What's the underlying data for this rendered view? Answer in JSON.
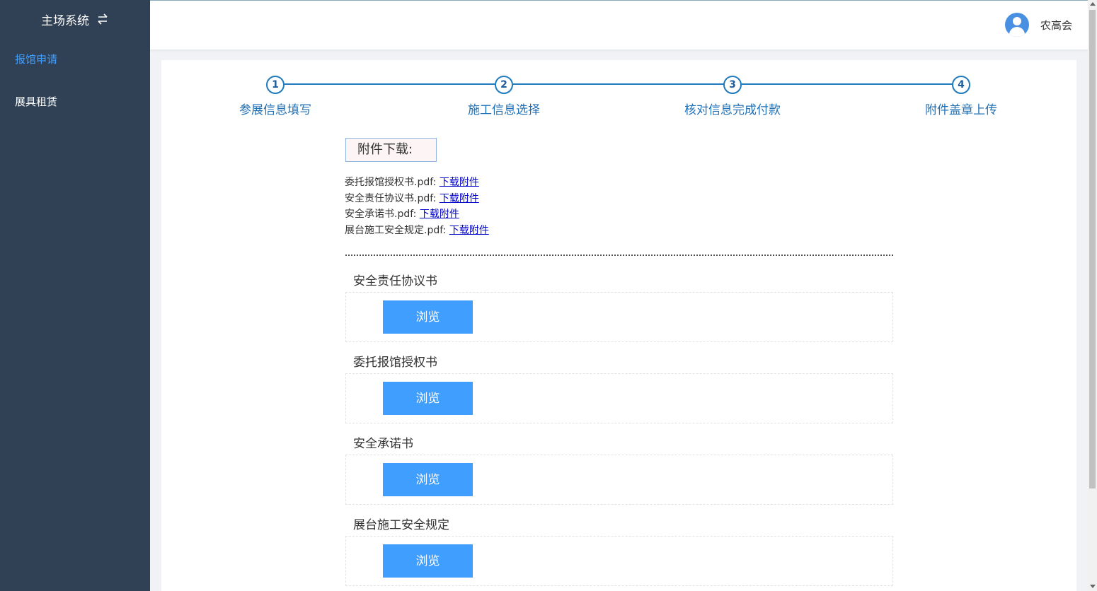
{
  "sidebar": {
    "title": "主场系统",
    "items": [
      {
        "label": "报馆申请",
        "active": true
      },
      {
        "label": "展具租赁",
        "active": false
      }
    ]
  },
  "header": {
    "user_name": "农高会"
  },
  "steps": [
    {
      "number": "1",
      "label": "参展信息填写"
    },
    {
      "number": "2",
      "label": "施工信息选择"
    },
    {
      "number": "3",
      "label": "核对信息完成付款"
    },
    {
      "number": "4",
      "label": "附件盖章上传"
    }
  ],
  "downloads": {
    "title": "附件下载:",
    "files": [
      {
        "name": "委托报馆授权书.pdf:",
        "link": "下载附件"
      },
      {
        "name": "安全责任协议书.pdf:",
        "link": "下载附件"
      },
      {
        "name": "安全承诺书.pdf:",
        "link": "下载附件"
      },
      {
        "name": "展台施工安全规定.pdf:",
        "link": "下载附件"
      }
    ]
  },
  "uploads": [
    {
      "label": "安全责任协议书",
      "button": "浏览"
    },
    {
      "label": "委托报馆授权书",
      "button": "浏览"
    },
    {
      "label": "安全承诺书",
      "button": "浏览"
    },
    {
      "label": "展台施工安全规定",
      "button": "浏览"
    }
  ],
  "colors": {
    "sidebar_bg": "#304156",
    "accent": "#409eff",
    "step_blue": "#1f7bbd",
    "link": "#0000cc"
  },
  "icons": {
    "swap": "swap-arrows-icon",
    "avatar": "user-avatar-icon"
  }
}
